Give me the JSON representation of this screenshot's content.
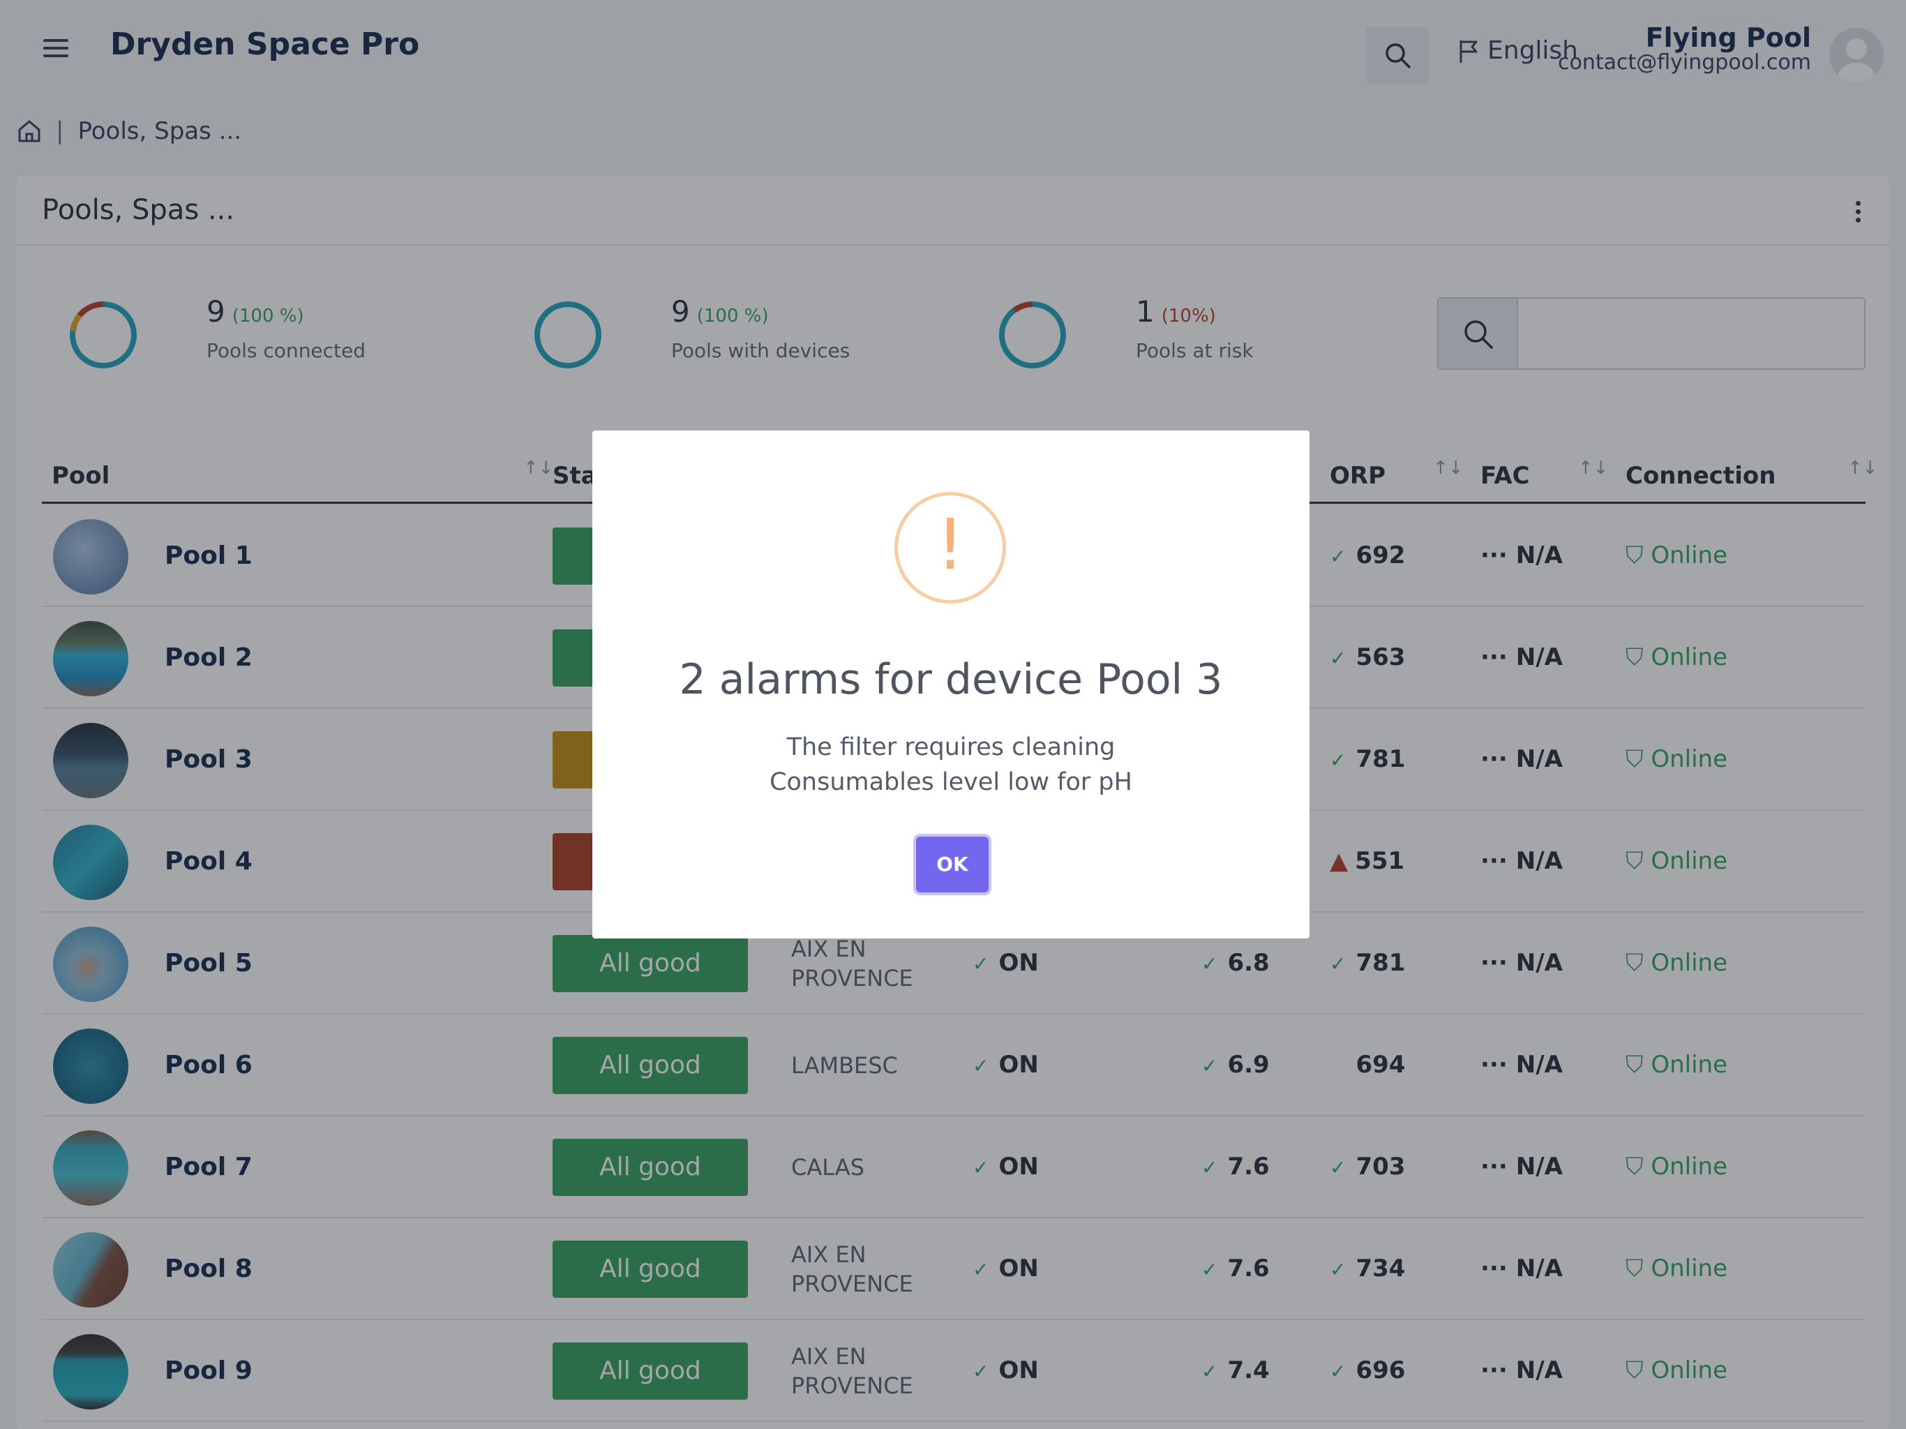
{
  "app": {
    "title": "Dryden Space Pro",
    "language": "English",
    "user_name": "Flying Pool",
    "user_email": "contact@flyingpool.com"
  },
  "breadcrumb": {
    "current": "Pools, Spas ...",
    "separator": "|"
  },
  "card": {
    "title": "Pools, Spas ..."
  },
  "stats": [
    {
      "value": "9",
      "percent": "(100 %)",
      "label": "Pools connected",
      "color": "#2e9e57"
    },
    {
      "value": "9",
      "percent": "(100 %)",
      "label": "Pools with devices",
      "color": "#2e9e57"
    },
    {
      "value": "1",
      "percent": "(10%)",
      "label": "Pools at risk",
      "color": "#b03a20"
    }
  ],
  "table": {
    "headers": {
      "pool": "Pool",
      "status": "Stat",
      "orp": "ORP",
      "fac": "FAC",
      "connection": "Connection"
    },
    "rows": [
      {
        "name": "Pool 1",
        "status": "",
        "city": "",
        "onoff": "",
        "ph": "",
        "orp": "692",
        "fac": "N/A",
        "connection": "Online"
      },
      {
        "name": "Pool 2",
        "status": "",
        "city": "",
        "onoff": "",
        "ph": "",
        "orp": "563",
        "fac": "N/A",
        "connection": "Online"
      },
      {
        "name": "Pool 3",
        "status": "",
        "city": "",
        "onoff": "",
        "ph": "",
        "orp": "781",
        "fac": "N/A",
        "connection": "Online"
      },
      {
        "name": "Pool 4",
        "status": "",
        "city": "",
        "onoff": "",
        "ph": "",
        "orp": "551",
        "fac": "N/A",
        "connection": "Online"
      },
      {
        "name": "Pool 5",
        "status": "All good",
        "city": "AIX EN PROVENCE",
        "onoff": "ON",
        "ph": "6.8",
        "orp": "781",
        "fac": "N/A",
        "connection": "Online"
      },
      {
        "name": "Pool 6",
        "status": "All good",
        "city": "LAMBESC",
        "onoff": "ON",
        "ph": "6.9",
        "orp": "694",
        "fac": "N/A",
        "connection": "Online"
      },
      {
        "name": "Pool 7",
        "status": "All good",
        "city": "CALAS",
        "onoff": "ON",
        "ph": "7.6",
        "orp": "703",
        "fac": "N/A",
        "connection": "Online"
      },
      {
        "name": "Pool 8",
        "status": "All good",
        "city": "AIX EN PROVENCE",
        "onoff": "ON",
        "ph": "7.6",
        "orp": "734",
        "fac": "N/A",
        "connection": "Online"
      },
      {
        "name": "Pool 9",
        "status": "All good",
        "city": "AIX EN PROVENCE",
        "onoff": "ON",
        "ph": "7.4",
        "orp": "696",
        "fac": "N/A",
        "connection": "Online"
      }
    ],
    "status_colors": {
      "good": "#2e9e57",
      "warning": "#c28a0a",
      "danger": "#a83a1e"
    }
  },
  "modal": {
    "icon": "warning-exclamation-icon",
    "title": "2 alarms for device Pool 3",
    "line1": "The filter requires cleaning",
    "line2": "Consumables level low for pH",
    "ok_label": "OK"
  }
}
